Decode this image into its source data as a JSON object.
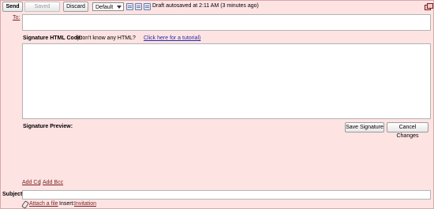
{
  "toolbar": {
    "send_label": "Send",
    "saved_label": "Saved",
    "discard_label": "Discard",
    "format_select": "Default",
    "status_text": "Draft autosaved at 2:11 AM (3 minutes ago)"
  },
  "to_label": "To:",
  "signature": {
    "html_label": "Signature HTML Code:",
    "hint": "(Don't know any HTML?",
    "tutorial_link": "Click here for a tutorial)",
    "preview_label": "Signature Preview:",
    "save_button": "Save Signature",
    "cancel_button": "Cancel Changes"
  },
  "cc_link": "Add Cc",
  "separator": "|",
  "bcc_link": "Add Bcc",
  "subject_label": "Subject:",
  "attach_link": "Attach a file",
  "insert_label": "Insert:",
  "invitation_link": "Invitation"
}
